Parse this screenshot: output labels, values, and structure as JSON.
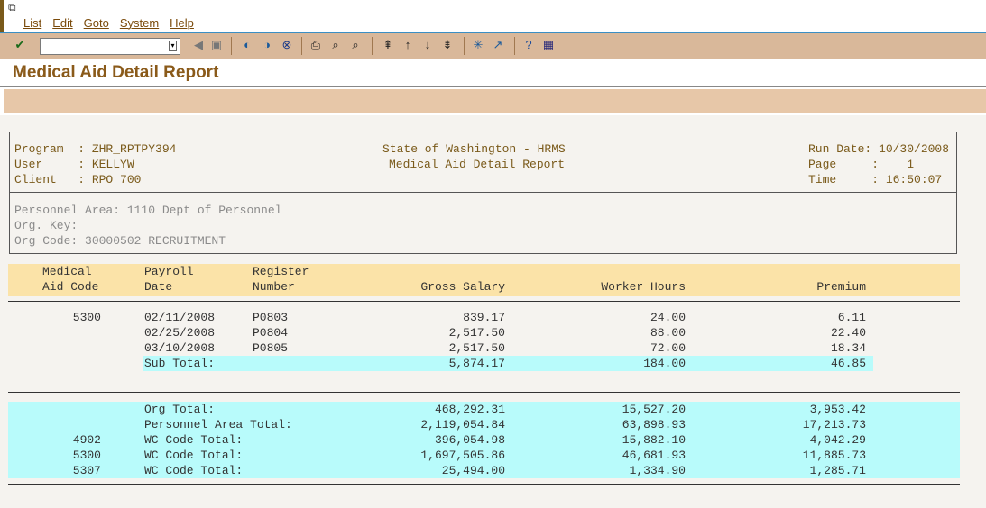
{
  "menu": [
    "List",
    "Edit",
    "Goto",
    "System",
    "Help"
  ],
  "page_title": "Medical Aid Detail Report",
  "header": {
    "program_label": "Program  : ZHR_RPTPY394",
    "user_label": "User     : KELLYW",
    "client_label": "Client   : RPO 700",
    "center1": "State of Washington - HRMS",
    "center2": "Medical Aid Detail Report",
    "run_date": "Run Date: 10/30/2008",
    "page": "Page     :    1",
    "time": "Time     : 16:50:07"
  },
  "org": {
    "personnel_area": "Personnel Area: 1110 Dept of Personnel",
    "org_key": "Org. Key:",
    "org_code": "Org Code: 30000502 RECRUITMENT"
  },
  "columns": {
    "c1a": "Medical",
    "c1b": "Aid Code",
    "c2a": "Payroll",
    "c2b": "Date",
    "c3a": "Register",
    "c3b": "Number",
    "c4": "Gross Salary",
    "c5": "Worker Hours",
    "c6": "Premium"
  },
  "detail": {
    "code": "5300",
    "rows": [
      {
        "date": "02/11/2008",
        "reg": "P0803",
        "gross": "839.17",
        "hours": "24.00",
        "premium": "6.11"
      },
      {
        "date": "02/25/2008",
        "reg": "P0804",
        "gross": "2,517.50",
        "hours": "88.00",
        "premium": "22.40"
      },
      {
        "date": "03/10/2008",
        "reg": "P0805",
        "gross": "2,517.50",
        "hours": "72.00",
        "premium": "18.34"
      }
    ],
    "subtotal": {
      "label": "Sub Total:",
      "gross": "5,874.17",
      "hours": "184.00",
      "premium": "46.85"
    }
  },
  "totals": [
    {
      "code": "",
      "label": "Org Total:",
      "gross": "468,292.31",
      "hours": "15,527.20",
      "premium": "3,953.42"
    },
    {
      "code": "",
      "label": "Personnel Area Total:",
      "gross": "2,119,054.84",
      "hours": "63,898.93",
      "premium": "17,213.73"
    },
    {
      "code": "4902",
      "label": "WC Code Total:",
      "gross": "396,054.98",
      "hours": "15,882.10",
      "premium": "4,042.29"
    },
    {
      "code": "5300",
      "label": "WC Code Total:",
      "gross": "1,697,505.86",
      "hours": "46,681.93",
      "premium": "11,885.73"
    },
    {
      "code": "5307",
      "label": "WC Code Total:",
      "gross": "25,494.00",
      "hours": "1,334.90",
      "premium": "1,285.71"
    }
  ]
}
